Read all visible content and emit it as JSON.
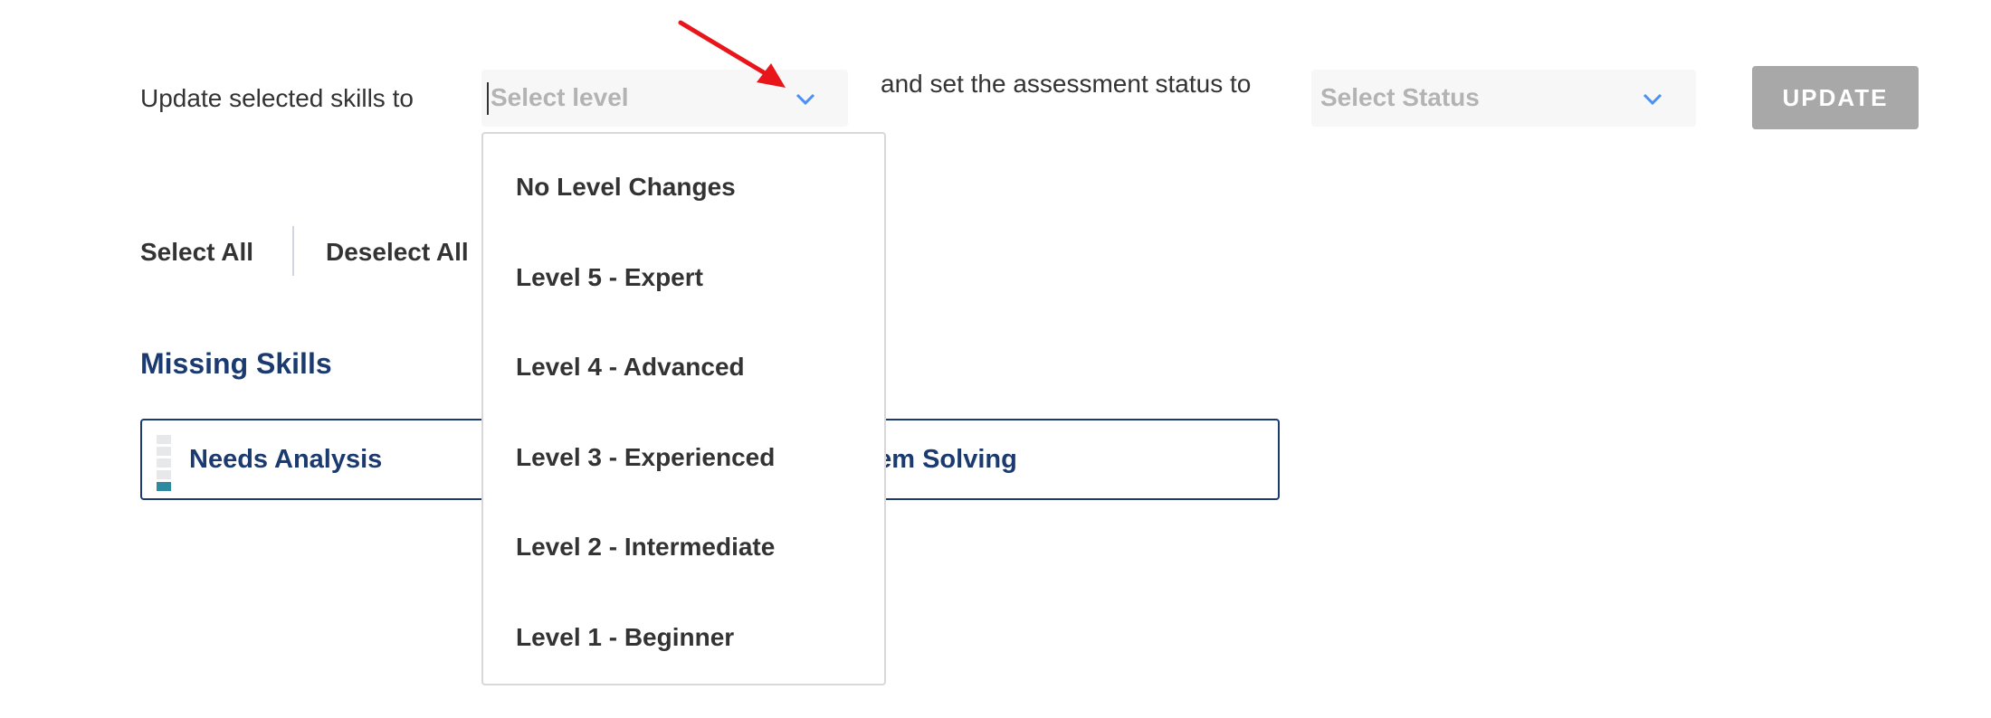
{
  "toolbar": {
    "prefix_label": "Update selected skills to",
    "level_select": {
      "placeholder": "Select level",
      "icon": "chevron-down-icon"
    },
    "status_label": "and set the assessment status to",
    "status_select": {
      "placeholder": "Select Status",
      "icon": "chevron-down-icon"
    },
    "update_label": "UPDATE"
  },
  "selection": {
    "select_all": "Select All",
    "deselect_all": "Deselect All"
  },
  "section": {
    "title": "Missing Skills",
    "skills": [
      {
        "name": "Needs Analysis",
        "level": 1,
        "max_level": 5
      },
      {
        "name": "Problem Solving"
      }
    ]
  },
  "level_dropdown": {
    "options": [
      "No Level Changes",
      "Level 5 - Expert",
      "Level 4 - Advanced",
      "Level 3 - Experienced",
      "Level 2 - Intermediate",
      "Level 1 - Beginner"
    ]
  },
  "colors": {
    "accent": "#4a90f5",
    "navy": "#1b3a6f",
    "button_disabled": "#a8a8a8",
    "annotation_arrow": "#e8161b",
    "level_fill": "#2e8aa0"
  }
}
